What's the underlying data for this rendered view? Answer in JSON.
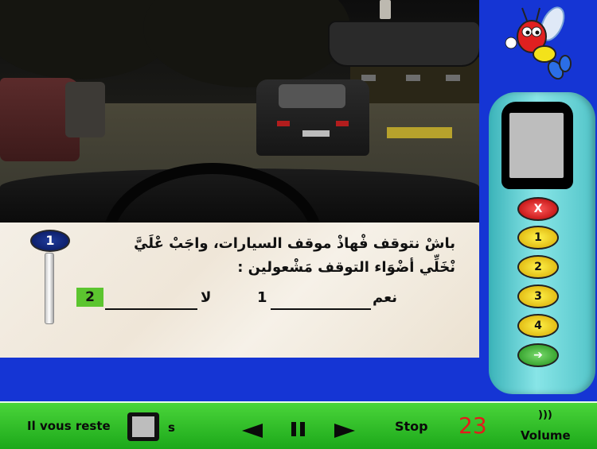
{
  "question": {
    "number": "1",
    "line1": "باشْ نتوقف فْهاذْ موقف السيارات، واجَبْ عْلَيَّ",
    "line2": "نْخَلِّي أضْوَاء التوقف مَشْعولين :",
    "options": [
      {
        "label": "نعم",
        "number": "1"
      },
      {
        "label": "لا",
        "number": "2"
      }
    ],
    "selected_answer": "2"
  },
  "remote": {
    "buttons": [
      {
        "id": "x",
        "label": "X"
      },
      {
        "id": "1",
        "label": "1"
      },
      {
        "id": "2",
        "label": "2"
      },
      {
        "id": "3",
        "label": "3"
      },
      {
        "id": "4",
        "label": "4"
      },
      {
        "id": "go",
        "label": "➔"
      }
    ]
  },
  "bottom_bar": {
    "remaining_label": "Il vous reste",
    "seconds_unit": "s",
    "stop_label": "Stop",
    "counter": "23",
    "volume_label": "Volume",
    "volume_icon": ")))"
  },
  "colors": {
    "background_blue": "#1535d4",
    "bar_green": "#2cbf28",
    "counter_red": "#e41b1b",
    "answer_green": "#5cc52f",
    "remote_teal": "#52c4c8"
  }
}
